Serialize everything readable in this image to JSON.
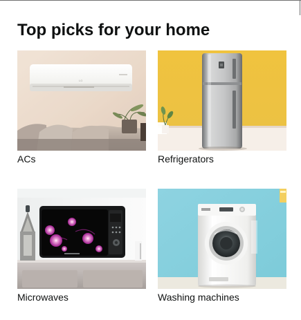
{
  "title": "Top picks for your home",
  "tiles": [
    {
      "label": "ACs",
      "image_icon": "air-conditioner-icon"
    },
    {
      "label": "Refrigerators",
      "image_icon": "refrigerator-icon"
    },
    {
      "label": "Microwaves",
      "image_icon": "microwave-icon"
    },
    {
      "label": "Washing machines",
      "image_icon": "washing-machine-icon"
    }
  ],
  "colors": {
    "text": "#0f1111",
    "ac_background": "#e7d8c8",
    "fridge_background": "#f2c84b",
    "microwave_background": "#f7f7f7",
    "washer_background": "#8fd2df"
  }
}
